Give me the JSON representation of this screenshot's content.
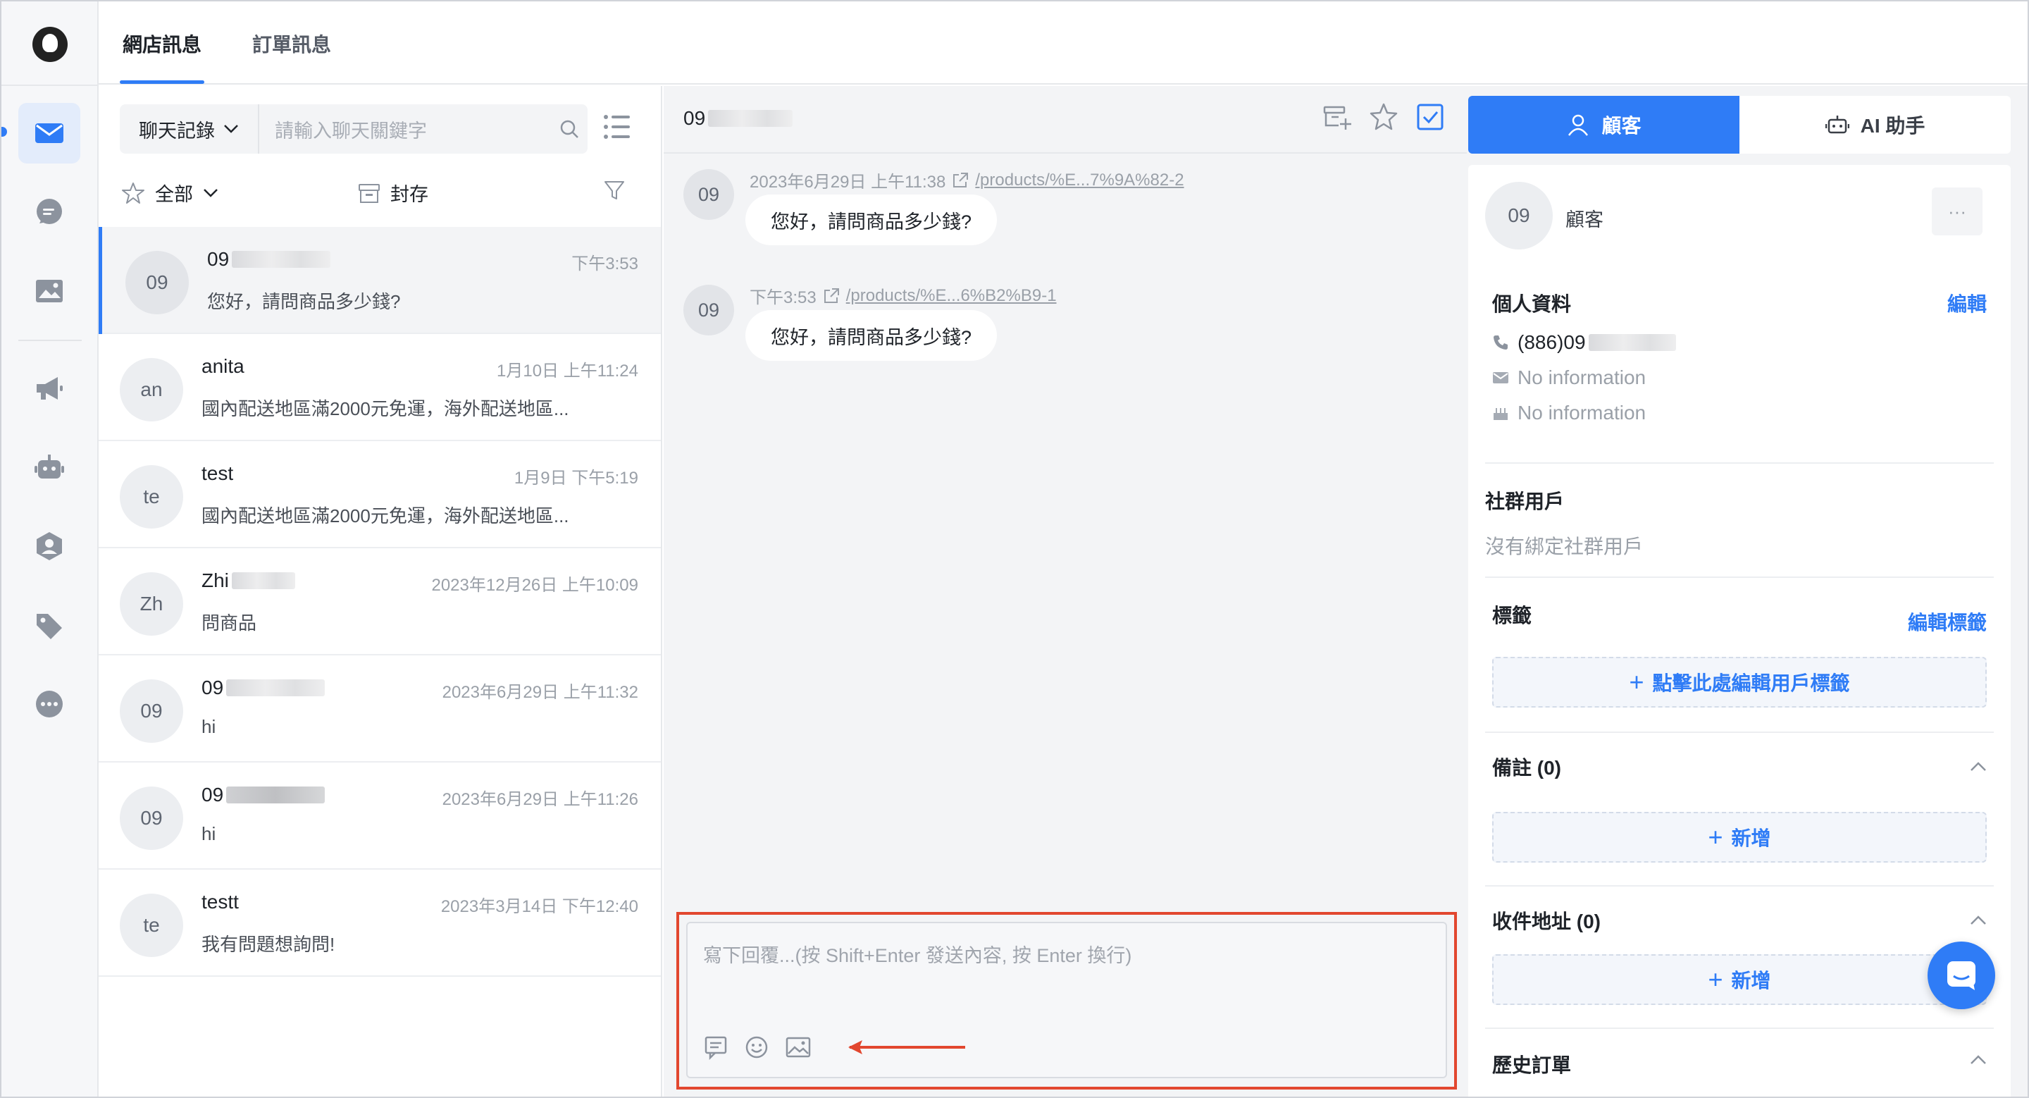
{
  "header": {
    "tabs": [
      {
        "label": "網店訊息",
        "active": true
      },
      {
        "label": "訂單訊息",
        "active": false
      }
    ]
  },
  "sidebar": {
    "items": [
      {
        "icon": "mail-icon",
        "active": true
      },
      {
        "icon": "chat-icon",
        "active": false
      },
      {
        "icon": "image-icon",
        "active": false
      },
      {
        "icon": "megaphone-icon",
        "active": false
      },
      {
        "icon": "robot-icon",
        "active": false
      },
      {
        "icon": "user-badge-icon",
        "active": false
      },
      {
        "icon": "tag-icon",
        "active": false
      },
      {
        "icon": "more-icon",
        "active": false
      }
    ]
  },
  "list": {
    "history_select": "聊天記錄",
    "search_placeholder": "請輸入聊天關鍵字",
    "filter_all": "全部",
    "archive": "封存",
    "conversations": [
      {
        "avatar": "09",
        "name": "09",
        "time": "下午3:53",
        "preview": "您好，請問商品多少錢?",
        "active": true
      },
      {
        "avatar": "an",
        "name": "anita",
        "time": "1月10日 上午11:24",
        "preview": "國內配送地區滿2000元免運，海外配送地區...",
        "active": false
      },
      {
        "avatar": "te",
        "name": "test",
        "time": "1月9日 下午5:19",
        "preview": "國內配送地區滿2000元免運，海外配送地區...",
        "active": false
      },
      {
        "avatar": "Zh",
        "name": "Zhi",
        "time": "2023年12月26日 上午10:09",
        "preview": "問商品",
        "active": false
      },
      {
        "avatar": "09",
        "name": "09",
        "time": "2023年6月29日 上午11:32",
        "preview": "hi",
        "active": false
      },
      {
        "avatar": "09",
        "name": "09",
        "time": "2023年6月29日 上午11:26",
        "preview": "hi",
        "active": false
      },
      {
        "avatar": "te",
        "name": "testt",
        "time": "2023年3月14日 下午12:40",
        "preview": "我有問題想詢問!",
        "active": false
      }
    ]
  },
  "chat": {
    "title": "09",
    "messages": [
      {
        "avatar": "09",
        "time": "2023年6月29日 上午11:38",
        "link": "/products/%E...7%9A%82-2",
        "text": "您好，請問商品多少錢?"
      },
      {
        "avatar": "09",
        "time": "下午3:53",
        "link": "/products/%E...6%B2%B9-1",
        "text": "您好，請問商品多少錢?"
      }
    ],
    "composer_placeholder": "寫下回覆...(按 Shift+Enter 發送內容, 按 Enter 換行)"
  },
  "panel": {
    "tab_customer": "顧客",
    "tab_ai": "AI 助手",
    "avatar": "09",
    "customer_label": "顧客",
    "more": "···",
    "profile_title": "個人資料",
    "edit": "編輯",
    "phone": "(886)09",
    "email": "No information",
    "birthday": "No information",
    "social_title": "社群用戶",
    "social_empty": "沒有綁定社群用戶",
    "tags_title": "標籤",
    "edit_tags": "編輯標籤",
    "add_tags": "點擊此處編輯用戶標籤",
    "notes_title": "備註 (0)",
    "add": "新增",
    "address_title": "收件地址 (0)",
    "orders_title": "歷史訂單"
  },
  "colors": {
    "accent": "#2f7cf6",
    "highlight_box": "#e2472f"
  }
}
